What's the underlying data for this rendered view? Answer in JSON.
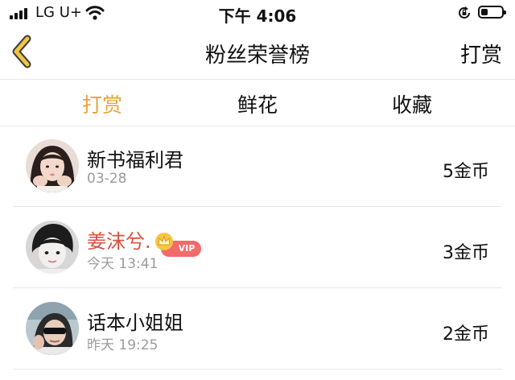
{
  "status_bar": {
    "carrier": "LG U+",
    "time": "下午 4:06",
    "battery_level": 0.35
  },
  "nav": {
    "title": "粉丝荣誉榜",
    "action_label": "打赏"
  },
  "tabs": [
    {
      "label": "打赏",
      "active": true
    },
    {
      "label": "鲜花",
      "active": false
    },
    {
      "label": "收藏",
      "active": false
    }
  ],
  "rows": [
    {
      "name": "新书福利君",
      "time": "03-28",
      "amount": "5金币",
      "vip": false
    },
    {
      "name": "姜沫兮.",
      "time": "今天 13:41",
      "amount": "3金币",
      "vip": true,
      "vip_label": "VIP"
    },
    {
      "name": "话本小姐姐",
      "time": "昨天 19:25",
      "amount": "2金币",
      "vip": false
    }
  ],
  "colors": {
    "accent": "#e8a33a",
    "vip_name": "#d9503f",
    "vip_badge": "#f26a6a",
    "muted": "#9b9b9b"
  }
}
